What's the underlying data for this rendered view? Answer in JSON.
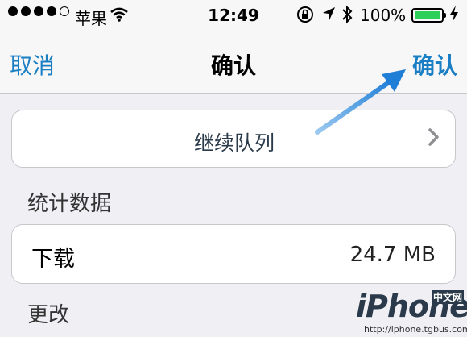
{
  "status_bar": {
    "carrier": "苹果",
    "time": "12:49",
    "battery_percent": "100%",
    "icons": [
      "signal-dots-icon",
      "wifi-icon",
      "rotation-lock-icon",
      "location-icon",
      "bluetooth-icon",
      "battery-icon",
      "charging-icon"
    ],
    "battery_color": "#2fd05a",
    "battery_level": 1.0
  },
  "nav": {
    "cancel_label": "取消",
    "title": "确认",
    "confirm_label": "确认",
    "tint_color": "#1a7ec4"
  },
  "queue": {
    "label": "继续队列"
  },
  "stats": {
    "header": "统计数据",
    "download_label": "下载",
    "download_value": "24.7 MB"
  },
  "change": {
    "header": "更改"
  },
  "watermark": {
    "logo": "iPhone",
    "tag": "中文网",
    "url": "http://iphone.tgbus.com"
  },
  "annotation": {
    "arrow_color": "#3a8fd8"
  }
}
